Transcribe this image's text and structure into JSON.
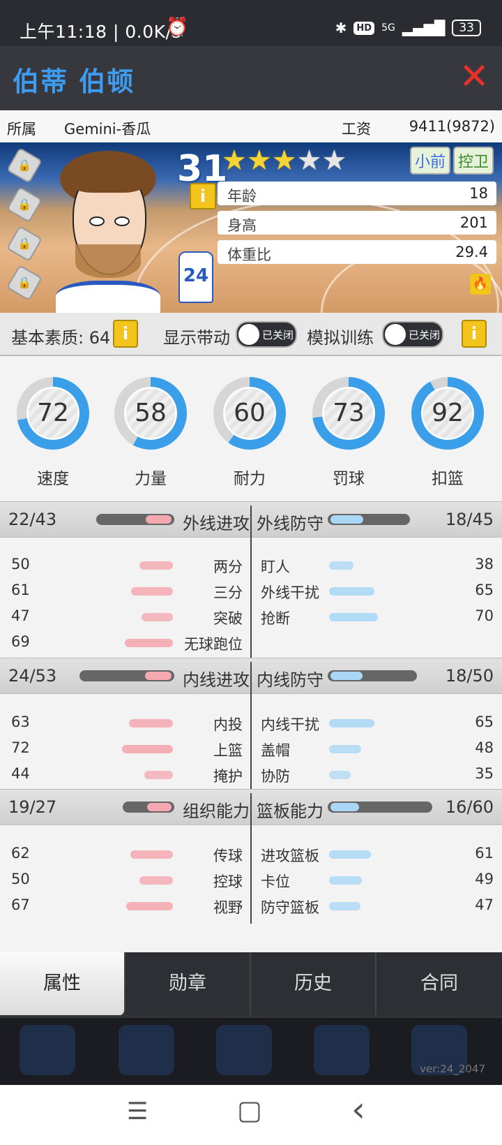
{
  "status_bar": {
    "time": "上午11:18 | 0.0K/s",
    "alarm": "⏰",
    "bluetooth": "✱",
    "hd": "HD",
    "network": "5G",
    "signal": "▂▄▆█",
    "battery": "33"
  },
  "player": {
    "name": "伯蒂 伯顿",
    "jersey": "24"
  },
  "team_row": {
    "team_label": "所属",
    "team": "Gemini-香瓜",
    "salary_label": "工资",
    "salary": "9411(9872)"
  },
  "card": {
    "overall": "31",
    "stars_filled": 3,
    "stars_total": 5,
    "positions": [
      "小前",
      "控卫"
    ],
    "info_icon": "i",
    "attributes": [
      {
        "label": "年龄",
        "value": "18"
      },
      {
        "label": "身高",
        "value": "201"
      },
      {
        "label": "体重比",
        "value": "29.4"
      }
    ]
  },
  "basic": {
    "label": "基本素质: 64",
    "show_drive": "显示带动",
    "sim_training": "模拟训练",
    "toggle_text": "已关闭"
  },
  "rings": [
    {
      "label": "速度",
      "value": "72"
    },
    {
      "label": "力量",
      "value": "58"
    },
    {
      "label": "耐力",
      "value": "60"
    },
    {
      "label": "罚球",
      "value": "73"
    },
    {
      "label": "扣篮",
      "value": "92"
    }
  ],
  "sections": [
    {
      "left_title": "外线进攻",
      "left_score": "22/43",
      "left_fill": 0.51,
      "right_title": "外线防守",
      "right_score": "18/45",
      "right_fill": 0.4,
      "left_items": [
        {
          "label": "两分",
          "value": "50"
        },
        {
          "label": "三分",
          "value": "61"
        },
        {
          "label": "突破",
          "value": "47"
        },
        {
          "label": "无球跑位",
          "value": "69"
        }
      ],
      "right_items": [
        {
          "label": "盯人",
          "value": "38"
        },
        {
          "label": "外线干扰",
          "value": "65"
        },
        {
          "label": "抢断",
          "value": "70"
        }
      ]
    },
    {
      "left_title": "内线进攻",
      "left_score": "24/53",
      "left_fill": 0.45,
      "right_title": "内线防守",
      "right_score": "18/50",
      "right_fill": 0.36,
      "left_items": [
        {
          "label": "内投",
          "value": "63"
        },
        {
          "label": "上篮",
          "value": "72"
        },
        {
          "label": "掩护",
          "value": "44"
        }
      ],
      "right_items": [
        {
          "label": "内线干扰",
          "value": "65"
        },
        {
          "label": "盖帽",
          "value": "48"
        },
        {
          "label": "协防",
          "value": "35"
        }
      ]
    },
    {
      "left_title": "组织能力",
      "left_score": "19/27",
      "left_fill": 0.7,
      "right_title": "篮板能力",
      "right_score": "16/60",
      "right_fill": 0.27,
      "left_items": [
        {
          "label": "传球",
          "value": "62"
        },
        {
          "label": "控球",
          "value": "50"
        },
        {
          "label": "视野",
          "value": "67"
        }
      ],
      "right_items": [
        {
          "label": "进攻篮板",
          "value": "61"
        },
        {
          "label": "卡位",
          "value": "49"
        },
        {
          "label": "防守篮板",
          "value": "47"
        }
      ]
    }
  ],
  "tabs": [
    {
      "label": "属性",
      "active": true
    },
    {
      "label": "勋章",
      "active": false
    },
    {
      "label": "历史",
      "active": false
    },
    {
      "label": "合同",
      "active": false
    }
  ],
  "version": "ver:24_2047",
  "nav": {
    "menu": "☰",
    "home": "▢",
    "back": "‹"
  },
  "colors": {
    "accent_blue": "#3d9cf0",
    "close_red": "#e8302b",
    "ring_blue": "#3a9ee8",
    "bar_pink": "#f4a8b0",
    "bar_blue": "#a9d7f5"
  }
}
